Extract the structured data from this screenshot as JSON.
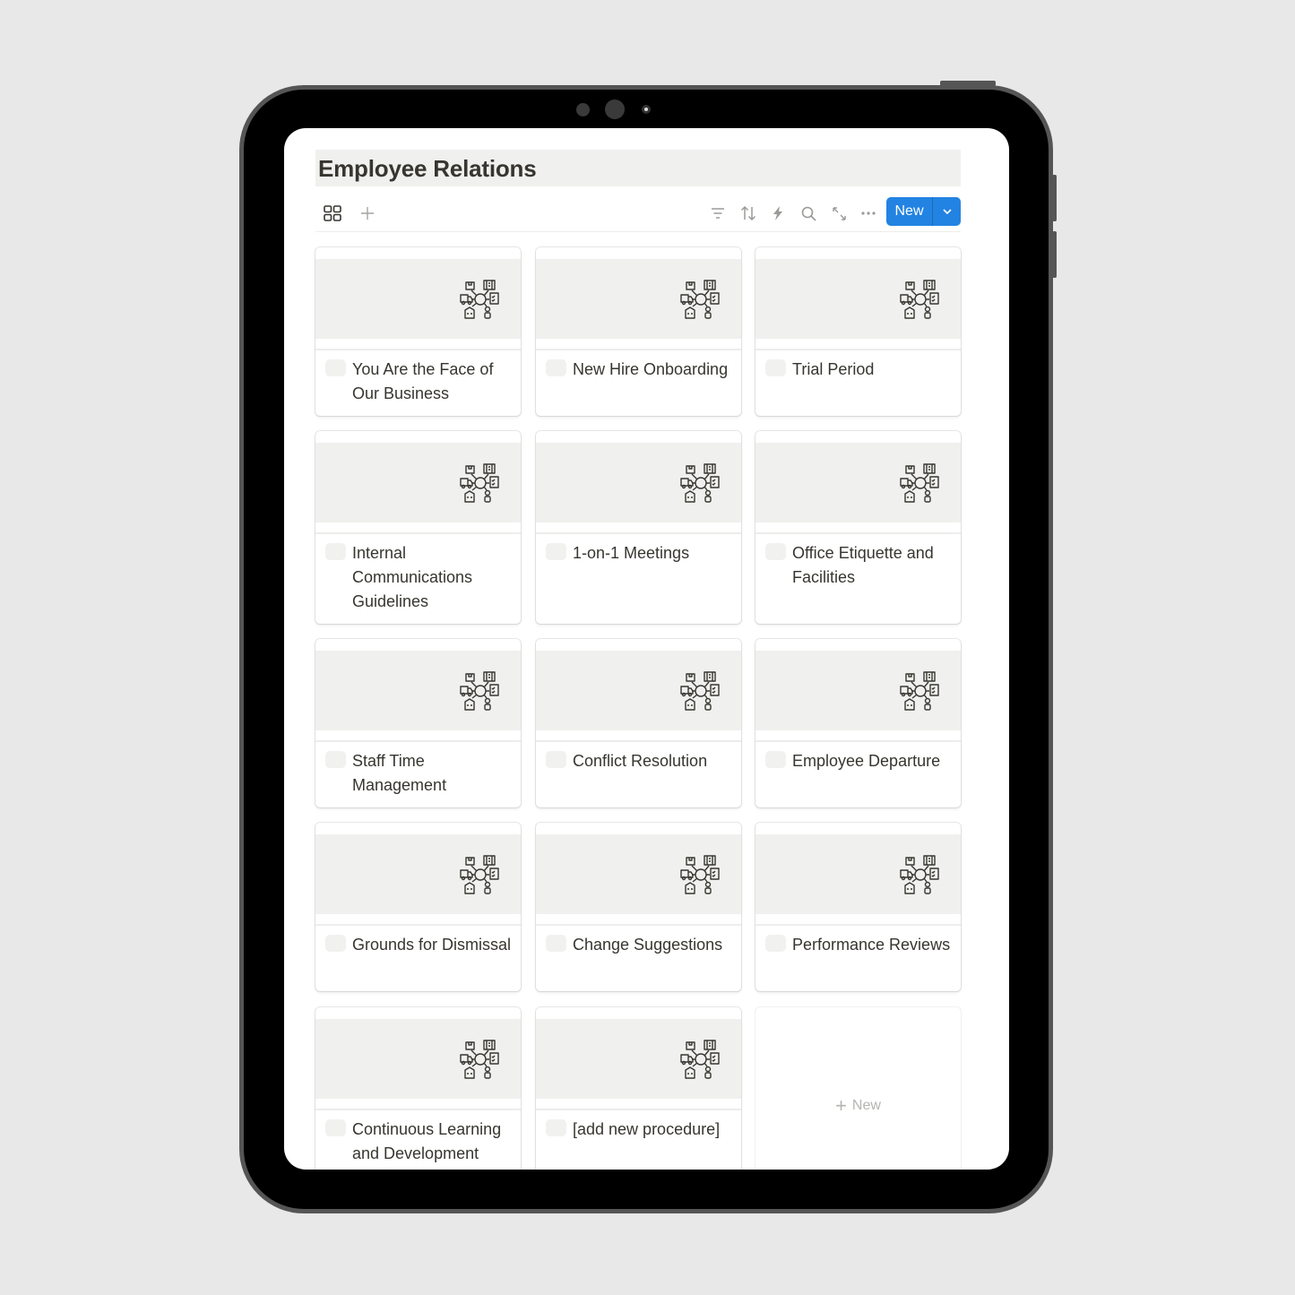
{
  "page": {
    "title": "Employee Relations"
  },
  "toolbar": {
    "view_icon": "gallery-view-icon",
    "add_view_icon": "plus-icon",
    "actions": [
      {
        "name": "filter",
        "icon": "filter-icon"
      },
      {
        "name": "sort",
        "icon": "sort-icon"
      },
      {
        "name": "automations",
        "icon": "lightning-icon"
      },
      {
        "name": "search",
        "icon": "search-icon"
      },
      {
        "name": "expand",
        "icon": "expand-icon"
      },
      {
        "name": "more",
        "icon": "more-icon"
      }
    ],
    "new_label": "New",
    "new_dropdown_icon": "chevron-down-icon",
    "accent_color": "#2383e2"
  },
  "cards": [
    {
      "title": "You Are the Face of Our Business",
      "cover_icon": "network-hub-icon"
    },
    {
      "title": "New Hire Onboarding",
      "cover_icon": "network-hub-icon"
    },
    {
      "title": "Trial Period",
      "cover_icon": "network-hub-icon"
    },
    {
      "title": "Internal Communications Guidelines",
      "cover_icon": "network-hub-icon"
    },
    {
      "title": "1-on-1 Meetings",
      "cover_icon": "network-hub-icon"
    },
    {
      "title": "Office Etiquette and Facilities",
      "cover_icon": "network-hub-icon"
    },
    {
      "title": "Staff Time Management",
      "cover_icon": "network-hub-icon"
    },
    {
      "title": "Conflict Resolution",
      "cover_icon": "network-hub-icon"
    },
    {
      "title": "Employee Departure",
      "cover_icon": "network-hub-icon"
    },
    {
      "title": "Grounds for Dismissal",
      "cover_icon": "network-hub-icon"
    },
    {
      "title": "Change Suggestions",
      "cover_icon": "network-hub-icon"
    },
    {
      "title": "Performance Reviews",
      "cover_icon": "network-hub-icon"
    },
    {
      "title": "Continuous Learning and Development",
      "cover_icon": "network-hub-icon"
    },
    {
      "title": "[add new procedure]",
      "cover_icon": "network-hub-icon"
    }
  ],
  "add_card": {
    "label": "New",
    "icon": "plus-icon"
  }
}
